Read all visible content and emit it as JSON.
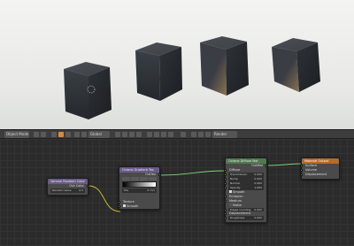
{
  "header": {
    "mode": "Object Mode",
    "orientation": "Global",
    "render_target": "Render Layer"
  },
  "nodes": {
    "voronoi": {
      "title": "Voronoi Random Color",
      "outputs": [
        "Out Color"
      ],
      "field_label": "Random Value",
      "field_value": "0.5"
    },
    "gradient": {
      "title": "Octane Gradient Tex",
      "output": "OutTex",
      "ramp_pos_label": "Pos",
      "ramp_pos_value": "0.711",
      "inputs": [
        "Texture",
        "Smooth"
      ]
    },
    "diffuse": {
      "title": "Octane Diffuse Mat",
      "output": "OutMat",
      "rows": [
        {
          "label": "Diffuse",
          "value": ""
        },
        {
          "label": "Transmission",
          "value": "0.000"
        },
        {
          "label": "Bump",
          "value": "0.000"
        },
        {
          "label": "Normal",
          "value": "0.000"
        },
        {
          "label": "Opacity",
          "value": "1.000"
        }
      ],
      "smooth_label": "Smooth",
      "emission_label": "Emission",
      "medium_label": "Medium",
      "matte_label": "Matte",
      "edges_rounding": {
        "label": "Edges rounding",
        "value": "0.000"
      },
      "displacement_label": "Displacement",
      "roughness": {
        "label": "Roughness",
        "value": "0.000"
      }
    },
    "output": {
      "title": "Material Output",
      "inputs": [
        "Surface",
        "Volume",
        "Displacement"
      ]
    }
  },
  "colors": {
    "texture_header": "#6a5a8a",
    "shader_header": "#4f7a4f",
    "output_header": "#b66a2b",
    "accent": "#d88a3c"
  }
}
